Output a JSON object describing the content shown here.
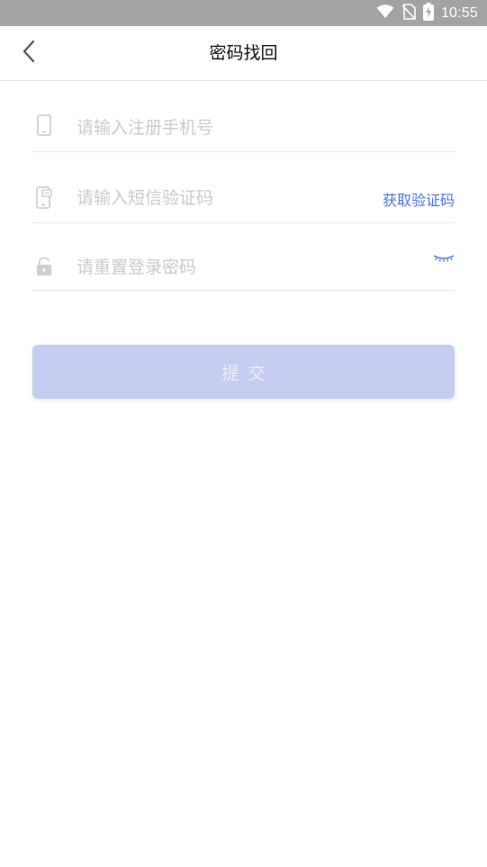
{
  "status_bar": {
    "time": "10:55",
    "icons": [
      "wifi-icon",
      "no-sim-icon",
      "battery-charging-icon"
    ]
  },
  "nav": {
    "back_icon": "chevron-left-icon",
    "title": "密码找回"
  },
  "form": {
    "phone": {
      "icon": "phone-icon",
      "placeholder": "请输入注册手机号",
      "value": ""
    },
    "sms": {
      "icon": "sms-phone-icon",
      "placeholder": "请输入短信验证码",
      "value": "",
      "get_code_label": "获取验证码"
    },
    "password": {
      "icon": "lock-icon",
      "placeholder": "请重置登录密码",
      "value": "",
      "toggle_icon": "eye-closed-icon"
    }
  },
  "submit": {
    "label": "提交"
  },
  "colors": {
    "accent": "#4c73e0",
    "submit_bg": "#c5cdf2",
    "status_bar_bg": "#a3a3a3",
    "placeholder": "#c9c9c9"
  }
}
